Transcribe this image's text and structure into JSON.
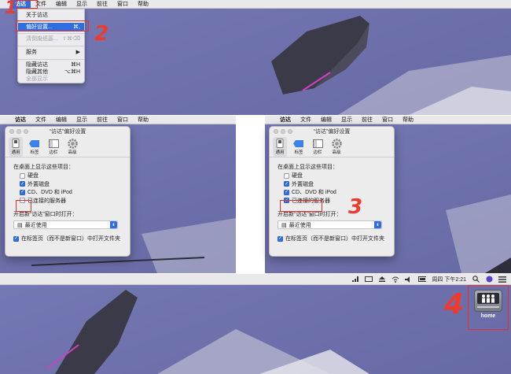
{
  "menubar": {
    "app": "访达",
    "items": [
      "文件",
      "编辑",
      "显示",
      "前往",
      "窗口",
      "帮助"
    ]
  },
  "dropdown": {
    "items": [
      {
        "label": "关于访达",
        "shortcut": "",
        "state": "normal"
      },
      {
        "label": "偏好设置...",
        "shortcut": "⌘,",
        "state": "selected"
      },
      {
        "label": "清倒废纸篓...",
        "shortcut": "⇧⌘⌫",
        "state": "disabled"
      },
      {
        "label": "服务",
        "shortcut": "▶",
        "state": "normal"
      },
      {
        "label": "隐藏访达",
        "shortcut": "⌘H",
        "state": "normal"
      },
      {
        "label": "隐藏其他",
        "shortcut": "⌥⌘H",
        "state": "normal"
      },
      {
        "label": "全部显示",
        "shortcut": "",
        "state": "disabled"
      }
    ]
  },
  "prefs": {
    "title": "“访达”偏好设置",
    "tabs": [
      {
        "label": "通用",
        "icon": "switch-icon"
      },
      {
        "label": "标签",
        "icon": "tag-icon"
      },
      {
        "label": "边栏",
        "icon": "sidebar-icon"
      },
      {
        "label": "高级",
        "icon": "gear-icon"
      }
    ],
    "desktop_heading": "在桌面上显示这些项目：",
    "checkboxes": [
      "硬盘",
      "外置磁盘",
      "CD、DVD 和 iPod",
      "已连接的服务器"
    ],
    "left_checked": [
      false,
      true,
      true,
      false
    ],
    "right_checked": [
      false,
      true,
      true,
      true
    ],
    "new_window_heading": "开启新“访达”窗口时打开：",
    "new_window_value": "最近使用",
    "tabs_option": "在标签页（而不是新窗口）中打开文件夹",
    "tabs_option_checked": true
  },
  "steps": [
    "1",
    "2",
    "3",
    "4"
  ],
  "status": {
    "clock": "周四 下午2:21",
    "icons": [
      "signal-icon",
      "keyboard-icon",
      "eject-icon",
      "wifi-icon",
      "volume-icon",
      "battery-icon",
      "search-icon",
      "siri-icon",
      "list-icon"
    ]
  },
  "drive": {
    "label": "home",
    "icon": "server-volume-icon"
  },
  "colors": {
    "accent": "#2d6ee0",
    "annotation": "#e53030",
    "desktop": "#6f72ad"
  }
}
